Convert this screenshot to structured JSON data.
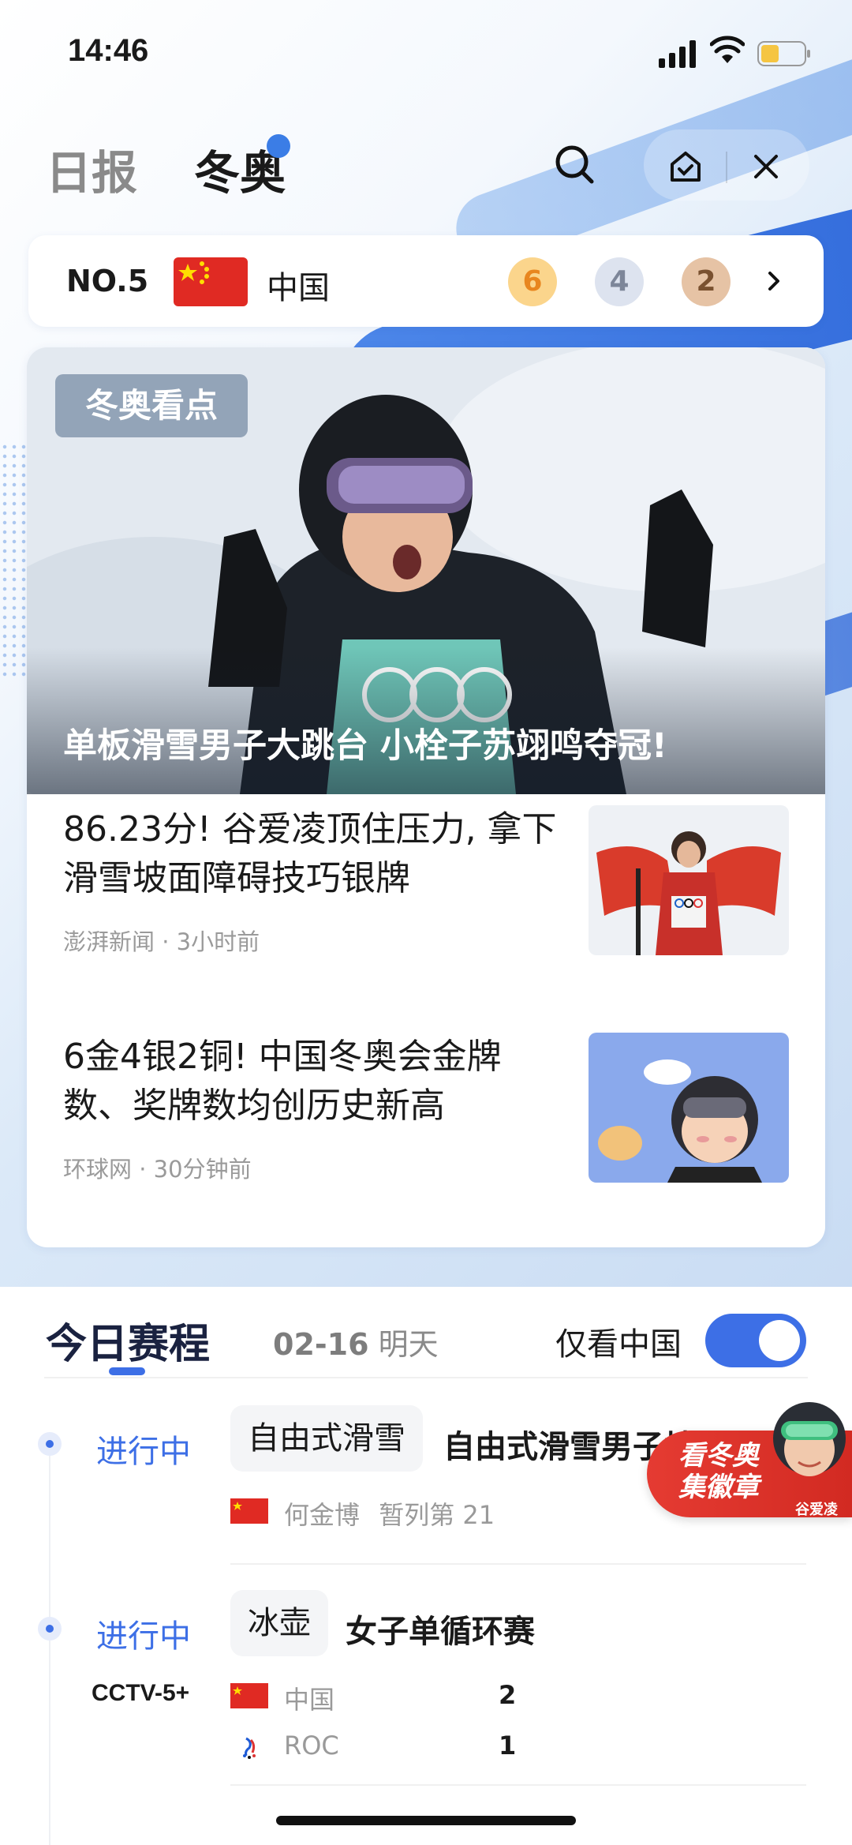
{
  "status_bar": {
    "time": "14:46"
  },
  "nav": {
    "tabs": [
      {
        "label": "日报"
      },
      {
        "label": "冬奥"
      }
    ]
  },
  "medal_bar": {
    "rank": "NO.5",
    "country": "中国",
    "gold": "6",
    "silver": "4",
    "bronze": "2"
  },
  "hero": {
    "tag": "冬奥看点",
    "title": "单板滑雪男子大跳台 小栓子苏翊鸣夺冠!"
  },
  "news": [
    {
      "title": "86.23分! 谷爱凌顶住压力, 拿下滑雪坡面障碍技巧银牌",
      "source": "澎湃新闻",
      "time": "3小时前"
    },
    {
      "title": "6金4银2铜! 中国冬奥会金牌数、奖牌数均创历史新高",
      "source": "环球网",
      "time": "30分钟前"
    }
  ],
  "schedule": {
    "tab_today": "今日赛程",
    "date": "02-16",
    "date_suffix": "明天",
    "filter_label": "仅看中国",
    "filter_on": true,
    "events": [
      {
        "status": "进行中",
        "sport": "自由式滑雪",
        "name": "自由式滑雪男子坡",
        "athlete": "何金博",
        "rank_text": "暂列第 21"
      },
      {
        "status": "进行中",
        "sport": "冰壶",
        "name": "女子单循环赛",
        "channel": "CCTV-5+",
        "teams": [
          {
            "name": "中国",
            "score": "2"
          },
          {
            "name": "ROC",
            "score": "1"
          }
        ]
      }
    ]
  },
  "float_badge": {
    "line1": "看冬奥",
    "line2": "集徽章",
    "name": "谷爱凌"
  },
  "colors": {
    "accent": "#3d6fe6",
    "live": "#3d6fe6",
    "flag_red": "#e02a23",
    "badge_red": "#e53b32"
  }
}
